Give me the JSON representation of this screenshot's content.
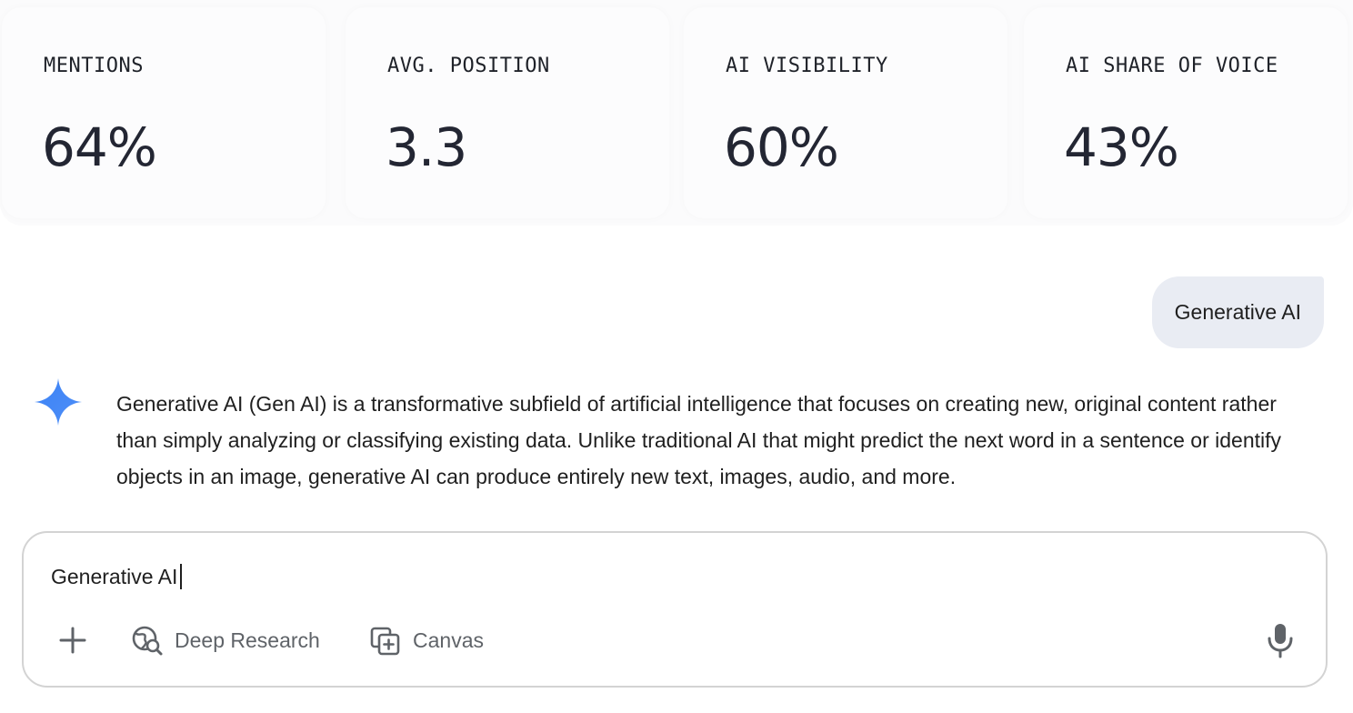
{
  "metrics": [
    {
      "label": "MENTIONS",
      "value": "64%"
    },
    {
      "label": "AVG. POSITION",
      "value": "3.3"
    },
    {
      "label": "AI VISIBILITY",
      "value": "60%"
    },
    {
      "label": "AI SHARE OF VOICE",
      "value": "43%"
    }
  ],
  "conversation": {
    "user_message": "Generative AI",
    "assistant_icon": "gemini-sparkle-icon",
    "assistant_response": "Generative AI (Gen AI) is a transformative subfield of artificial intelligence that focuses on creating new, original content rather than simply analyzing or classifying existing data. Unlike traditional AI that might predict the next word in a sentence or identify objects in an image, generative AI can produce entirely new text, images, audio, and more."
  },
  "composer": {
    "input_value": "Generative AI",
    "tools": {
      "add_icon": "plus-icon",
      "deep_research_label": "Deep Research",
      "deep_research_icon": "globe-search-icon",
      "canvas_label": "Canvas",
      "canvas_icon": "canvas-add-icon",
      "mic_icon": "microphone-icon"
    }
  },
  "colors": {
    "accent_blue": "#4285f4",
    "bubble_bg": "#e9ecf3",
    "icon_gray": "#5f6368"
  }
}
